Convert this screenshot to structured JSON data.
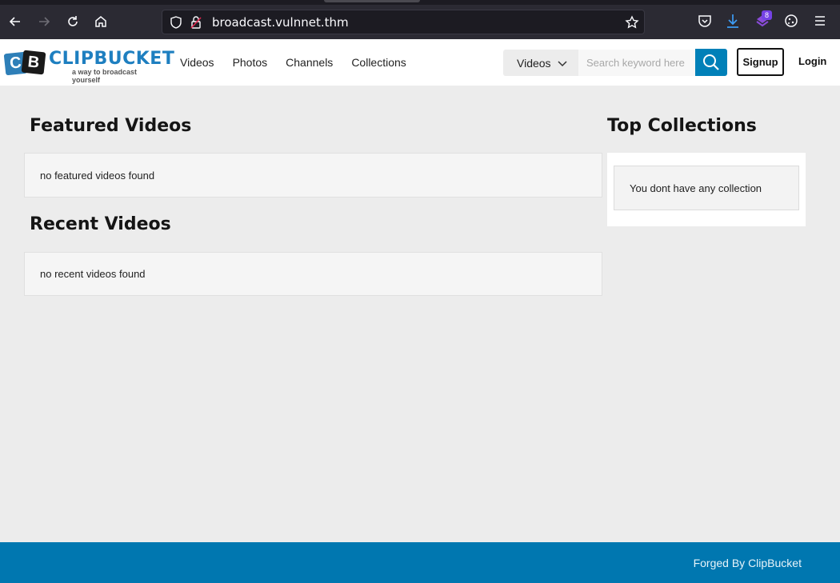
{
  "browser": {
    "url": "broadcast.vulnnet.thm",
    "extension_badge": "8"
  },
  "site": {
    "logo_letters": [
      "C",
      "B"
    ],
    "brand": "CLIPBUCKET",
    "tagline": "a way to broadcast yourself",
    "nav": [
      "Videos",
      "Photos",
      "Channels",
      "Collections"
    ],
    "search": {
      "type_selected": "Videos",
      "placeholder": "Search keyword here"
    },
    "signup_label": "Signup",
    "login_label": "Login",
    "accent_color": "#0080b8"
  },
  "featured": {
    "title": "Featured Videos",
    "empty_text": "no featured videos found"
  },
  "recent": {
    "title": "Recent Videos",
    "empty_text": "no recent videos found"
  },
  "collections": {
    "title": "Top Collections",
    "empty_text": "You dont have any collection"
  },
  "footer": {
    "text": "Forged By ClipBucket"
  }
}
